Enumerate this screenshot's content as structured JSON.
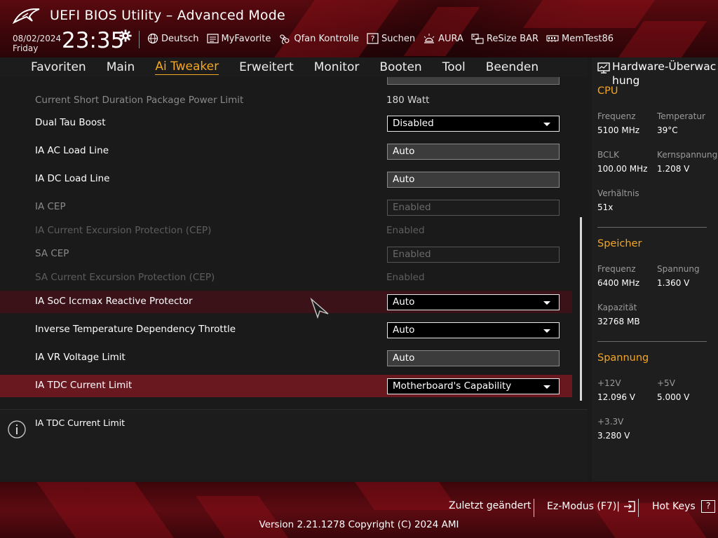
{
  "header": {
    "title": "UEFI BIOS Utility – Advanced Mode",
    "date": "08/02/2024",
    "weekday": "Friday",
    "time": "23:35",
    "toolbar": [
      {
        "label": "Deutsch",
        "icon": "globe-icon"
      },
      {
        "label": "MyFavorite",
        "icon": "favorite-list-icon"
      },
      {
        "label": "Qfan Kontrolle",
        "icon": "fan-icon"
      },
      {
        "label": "Suchen",
        "icon": "search-help-icon"
      },
      {
        "label": "AURA",
        "icon": "aura-light-icon"
      },
      {
        "label": "ReSize BAR",
        "icon": "resize-bar-icon"
      },
      {
        "label": "MemTest86",
        "icon": "memory-icon"
      }
    ]
  },
  "nav": {
    "tabs": [
      "Favoriten",
      "Main",
      "Ai Tweaker",
      "Erweitert",
      "Monitor",
      "Booten",
      "Tool",
      "Beenden"
    ],
    "active": "Ai Tweaker"
  },
  "settings": [
    {
      "label": "Current Short Duration Package Power Limit",
      "value": "180 Watt",
      "type": "text",
      "state": "dim"
    },
    {
      "label": "Dual Tau Boost",
      "value": "Disabled",
      "type": "dropdown",
      "state": "normal"
    },
    {
      "label": "IA AC Load Line",
      "value": "Auto",
      "type": "input",
      "state": "normal"
    },
    {
      "label": "IA DC Load Line",
      "value": "Auto",
      "type": "input",
      "state": "normal"
    },
    {
      "label": "IA CEP",
      "value": "Enabled",
      "type": "input",
      "state": "dim"
    },
    {
      "label": "IA Current Excursion Protection (CEP)",
      "value": "Enabled",
      "type": "text",
      "state": "faint"
    },
    {
      "label": "SA CEP",
      "value": "Enabled",
      "type": "input",
      "state": "dim"
    },
    {
      "label": "SA Current Excursion Protection (CEP)",
      "value": "Enabled",
      "type": "text",
      "state": "faint"
    },
    {
      "label": "IA SoC Iccmax Reactive Protector",
      "value": "Auto",
      "type": "dropdown",
      "state": "hover"
    },
    {
      "label": "Inverse Temperature Dependency Throttle",
      "value": "Auto",
      "type": "dropdown",
      "state": "normal"
    },
    {
      "label": "IA VR Voltage Limit",
      "value": "Auto",
      "type": "input",
      "state": "normal"
    },
    {
      "label": "IA TDC Current Limit",
      "value": "Motherboard's Capability",
      "type": "dropdown",
      "state": "selected"
    }
  ],
  "help": {
    "text": "IA TDC Current Limit"
  },
  "hardware": {
    "title_line1": "Hardware-Überwac",
    "title_line2": "hung",
    "cpu": {
      "heading": "CPU",
      "freq_label": "Frequenz",
      "freq_value": "5100 MHz",
      "temp_label": "Temperatur",
      "temp_value": "39°C",
      "bclk_label": "BCLK",
      "bclk_value": "100.00 MHz",
      "core_v_label": "Kernspannung",
      "core_v_value": "1.208 V",
      "ratio_label": "Verhältnis",
      "ratio_value": "51x"
    },
    "memory": {
      "heading": "Speicher",
      "freq_label": "Frequenz",
      "freq_value": "6400 MHz",
      "volt_label": "Spannung",
      "volt_value": "1.360 V",
      "cap_label": "Kapazität",
      "cap_value": "32768 MB"
    },
    "voltage": {
      "heading": "Spannung",
      "v12_label": "+12V",
      "v12_value": "12.096 V",
      "v5_label": "+5V",
      "v5_value": "5.000 V",
      "v33_label": "+3.3V",
      "v33_value": "3.280 V"
    }
  },
  "footer": {
    "last_modified": "Zuletzt geändert",
    "ez_mode": "Ez-Modus (F7)|",
    "hot_keys": "Hot Keys",
    "hot_keys_key": "?",
    "version": "Version 2.21.1278 Copyright (C) 2024 AMI"
  },
  "colors": {
    "accent": "#f5a623",
    "selected_row": "#6a1820",
    "hover_row": "#3a1218",
    "brand_red": "#5a0a10"
  }
}
